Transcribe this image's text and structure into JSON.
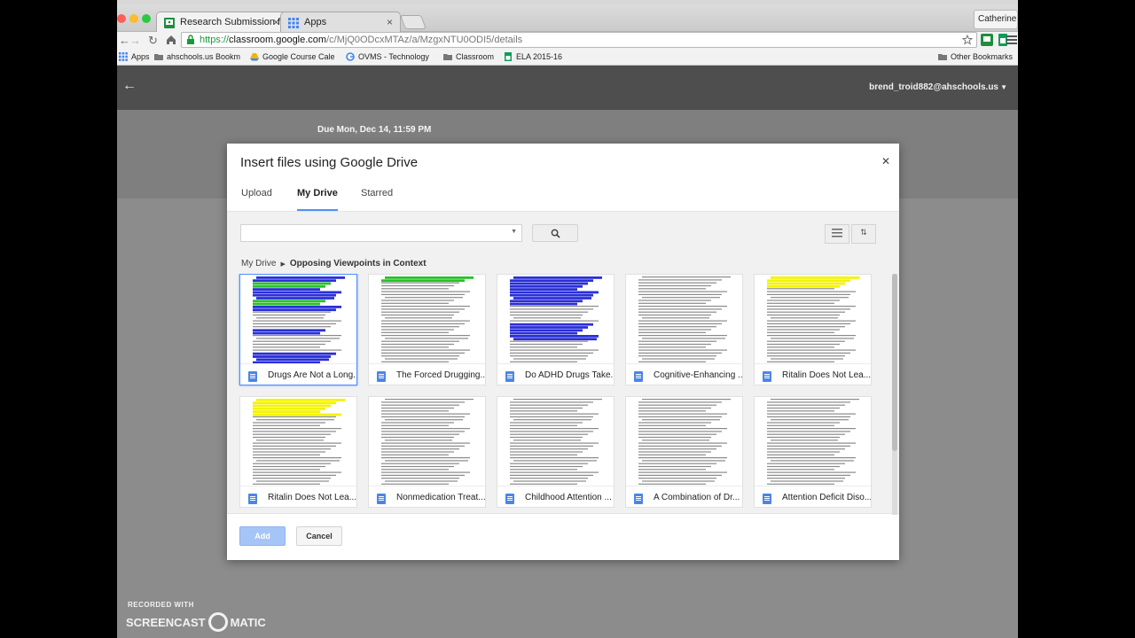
{
  "tabs": [
    {
      "label": "Research Submission for y",
      "active": true
    },
    {
      "label": "Apps",
      "active": false
    }
  ],
  "profile_button": "Catherine",
  "address_bar": {
    "scheme": "https://",
    "domain": "classroom.google.com",
    "path": "/c/MjQ0ODcxMTAz/a/MzgxNTU0ODI5/details"
  },
  "bookmarks": [
    {
      "label": "Apps",
      "icon": "apps-grid-icon"
    },
    {
      "label": "ahschools.us Bookm",
      "icon": "folder-icon"
    },
    {
      "label": "Google Course Cale",
      "icon": "drive-icon"
    },
    {
      "label": "OVMS - Technology",
      "icon": "google-g-icon"
    },
    {
      "label": "Classroom",
      "icon": "folder-icon"
    },
    {
      "label": "ELA 2015-16",
      "icon": "sheets-icon"
    }
  ],
  "other_bookmarks": "Other Bookmarks",
  "classroom": {
    "account": "brend_troid882@ahschools.us",
    "due": "Due Mon, Dec 14, 11:59 PM"
  },
  "dialog": {
    "title": "Insert files using Google Drive",
    "tabs": [
      "Upload",
      "My Drive",
      "Starred"
    ],
    "active_tab": "My Drive",
    "breadcrumb": {
      "root": "My Drive",
      "current": "Opposing Viewpoints in Context"
    },
    "files": [
      {
        "name": "Drugs Are Not a Long...",
        "selected": true
      },
      {
        "name": "The Forced Drugging..."
      },
      {
        "name": "Do ADHD Drugs Take..."
      },
      {
        "name": "Cognitive-Enhancing ..."
      },
      {
        "name": "Ritalin Does Not Lea..."
      },
      {
        "name": "Ritalin Does Not Lea..."
      },
      {
        "name": "Nonmedication Treat..."
      },
      {
        "name": "Childhood Attention ..."
      },
      {
        "name": "A Combination of Dr..."
      },
      {
        "name": "Attention Deficit Diso..."
      }
    ],
    "add_label": "Add",
    "cancel_label": "Cancel"
  },
  "watermark": {
    "top": "RECORDED WITH",
    "left": "SCREENCAST",
    "right": "MATIC"
  },
  "colors": {
    "accent_blue": "#4d90fe",
    "add_button": "#a6c5f7",
    "doc_icon": "#4a86e8",
    "highlight_yellow": "#f4f400",
    "highlight_blue": "#2a2fd8",
    "highlight_green": "#27c227"
  }
}
